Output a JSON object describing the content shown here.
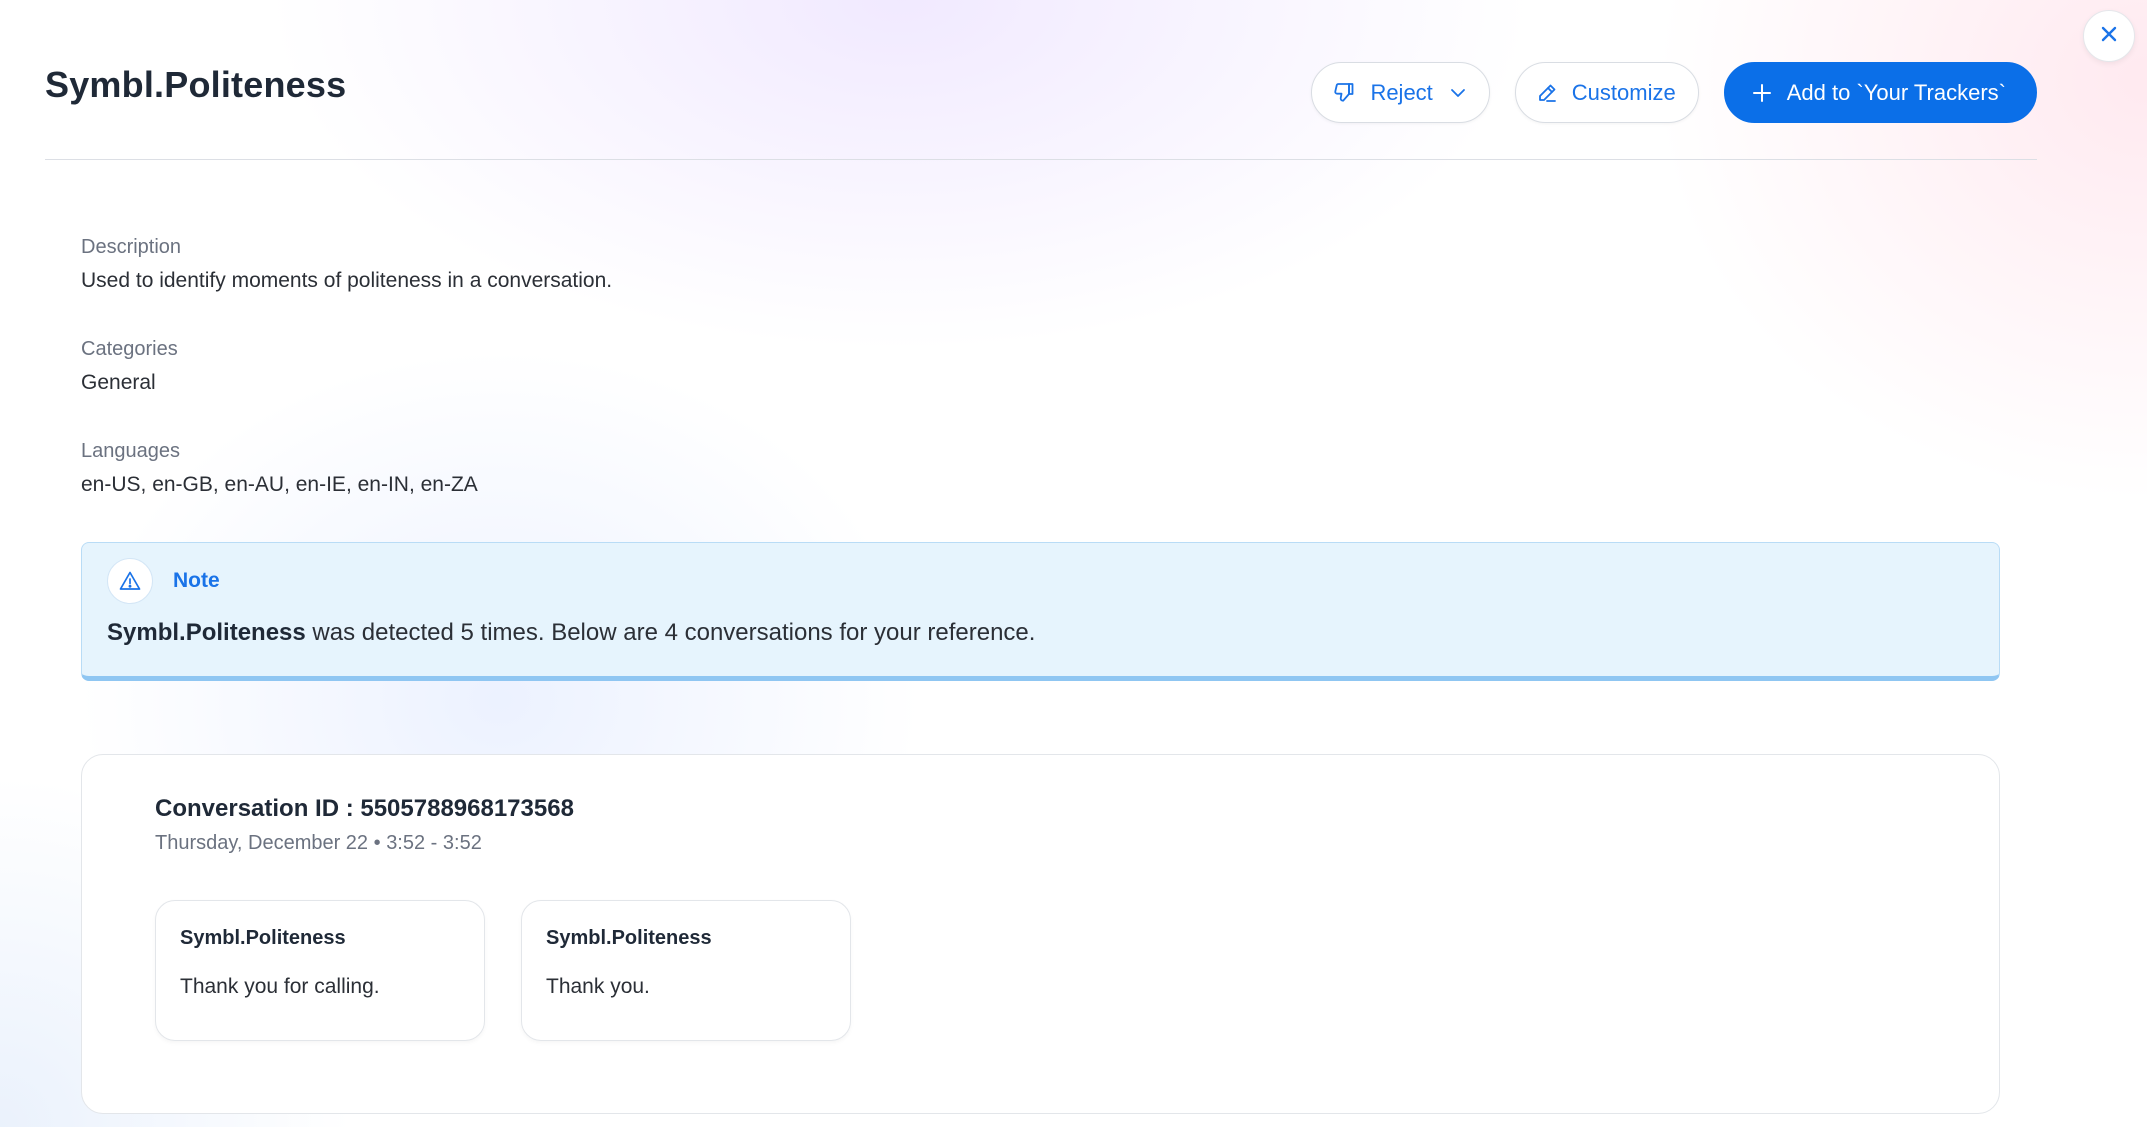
{
  "header": {
    "title": "Symbl.Politeness",
    "actions": {
      "reject_label": "Reject",
      "customize_label": "Customize",
      "add_label": "Add to `Your Trackers`"
    }
  },
  "details": {
    "description": {
      "label": "Description",
      "value": "Used to identify moments of politeness in a conversation."
    },
    "categories": {
      "label": "Categories",
      "value": "General"
    },
    "languages": {
      "label": "Languages",
      "value": "en-US, en-GB, en-AU, en-IE, en-IN, en-ZA"
    }
  },
  "note": {
    "title": "Note",
    "tracker_name": "Symbl.Politeness",
    "message": " was detected 5 times. Below are 4 conversations for your reference."
  },
  "conversations": [
    {
      "title": "Conversation ID : 5505788968173568",
      "date": "Thursday, December 22",
      "time": "3:52 - 3:52",
      "moments": [
        {
          "tracker": "Symbl.Politeness",
          "text": "Thank you for calling."
        },
        {
          "tracker": "Symbl.Politeness",
          "text": "Thank you."
        }
      ]
    }
  ],
  "colors": {
    "accent": "#1a73e8",
    "primary_button": "#0b6fe8",
    "note_background": "#e6f4fd",
    "note_border": "#8fc6f2"
  },
  "icons": {
    "close": "close-icon",
    "reject": "thumbs-down-icon",
    "reject_menu": "chevron-down-icon",
    "customize": "pencil-icon",
    "add": "plus-icon",
    "note": "warning-triangle-icon"
  }
}
